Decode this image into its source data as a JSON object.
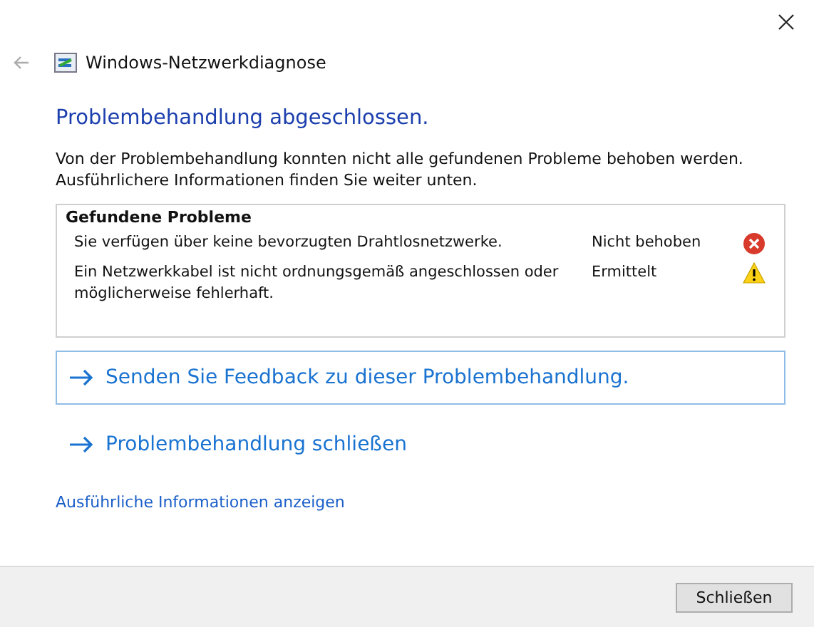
{
  "window": {
    "title": "Windows-Netzwerkdiagnose"
  },
  "heading": "Problembehandlung abgeschlossen.",
  "description": "Von der Problembehandlung konnten nicht alle gefundenen Probleme behoben werden. Ausführlichere Informationen finden Sie weiter unten.",
  "problems": {
    "title": "Gefundene Probleme",
    "items": [
      {
        "text": "Sie verfügen über keine bevorzugten Drahtlosnetzwerke.",
        "status": "Nicht behoben",
        "kind": "error"
      },
      {
        "text": "Ein Netzwerkkabel ist nicht ordnungsgemäß angeschlossen oder möglicherweise fehlerhaft.",
        "status": "Ermittelt",
        "kind": "warning"
      }
    ]
  },
  "command_links": [
    {
      "label": "Senden Sie Feedback zu dieser Problembehandlung.",
      "highlighted": true
    },
    {
      "label": "Problembehandlung schließen",
      "highlighted": false
    }
  ],
  "details_link": "Ausführliche Informationen anzeigen",
  "buttons": [
    "Schließen"
  ]
}
